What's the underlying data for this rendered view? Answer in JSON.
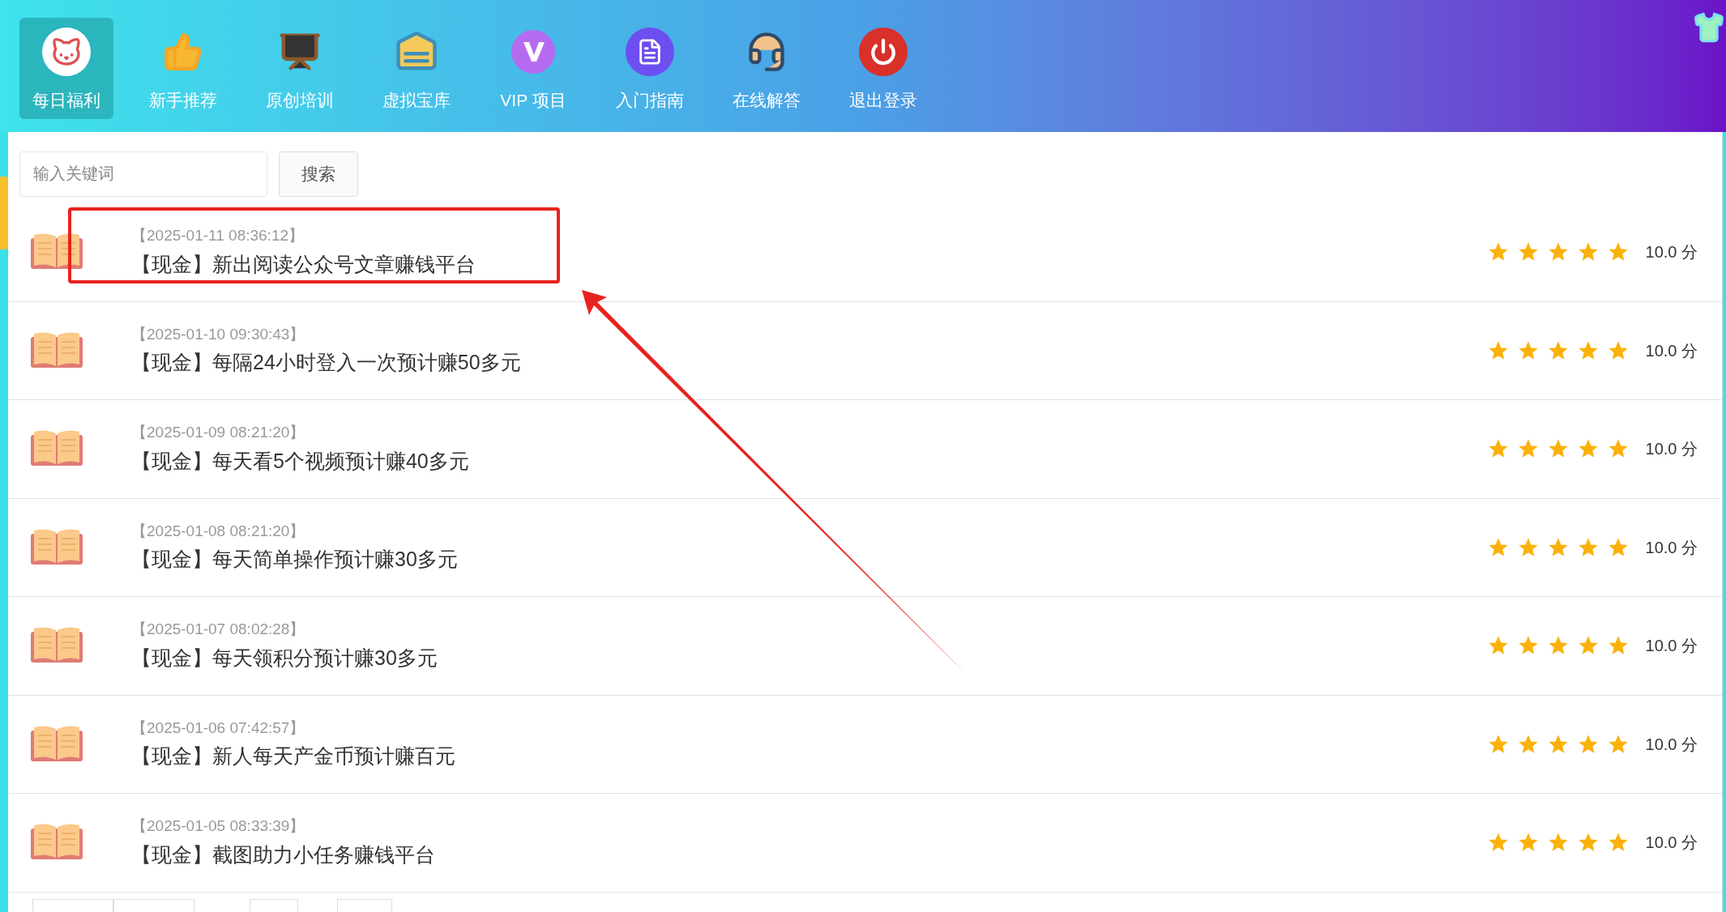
{
  "nav": [
    {
      "label": "每日福利",
      "selected": true
    },
    {
      "label": "新手推荐",
      "selected": false
    },
    {
      "label": "原创培训",
      "selected": false
    },
    {
      "label": "虚拟宝库",
      "selected": false
    },
    {
      "label": "VIP 项目",
      "selected": false
    },
    {
      "label": "入门指南",
      "selected": false
    },
    {
      "label": "在线解答",
      "selected": false
    },
    {
      "label": "退出登录",
      "selected": false
    }
  ],
  "search": {
    "placeholder": "输入关键词",
    "button": "搜索"
  },
  "items": [
    {
      "date": "【2025-01-11 08:36:12】",
      "title": "【现金】新出阅读公众号文章赚钱平台",
      "stars": 5,
      "score": "10.0 分"
    },
    {
      "date": "【2025-01-10 09:30:43】",
      "title": "【现金】每隔24小时登入一次预计赚50多元",
      "stars": 5,
      "score": "10.0 分"
    },
    {
      "date": "【2025-01-09 08:21:20】",
      "title": "【现金】每天看5个视频预计赚40多元",
      "stars": 5,
      "score": "10.0 分"
    },
    {
      "date": "【2025-01-08 08:21:20】",
      "title": "【现金】每天简单操作预计赚30多元",
      "stars": 5,
      "score": "10.0 分"
    },
    {
      "date": "【2025-01-07 08:02:28】",
      "title": "【现金】每天领积分预计赚30多元",
      "stars": 5,
      "score": "10.0 分"
    },
    {
      "date": "【2025-01-06 07:42:57】",
      "title": "【现金】新人每天产金币预计赚百元",
      "stars": 5,
      "score": "10.0 分"
    },
    {
      "date": "【2025-01-05 08:33:39】",
      "title": "【现金】截图助力小任务赚钱平台",
      "stars": 5,
      "score": "10.0 分"
    }
  ]
}
